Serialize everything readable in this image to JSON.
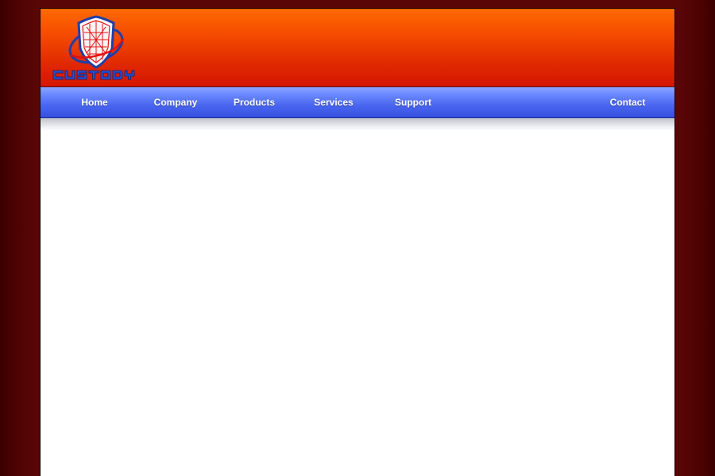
{
  "brand": {
    "logo_text": "CUSTODY"
  },
  "nav": {
    "items": [
      {
        "id": "home",
        "label": "Home"
      },
      {
        "id": "company",
        "label": "Company"
      },
      {
        "id": "products",
        "label": "Products"
      },
      {
        "id": "services",
        "label": "Services"
      },
      {
        "id": "support",
        "label": "Support"
      },
      {
        "id": "contact",
        "label": "Contact"
      }
    ]
  },
  "colors": {
    "background": "#5a0606",
    "header_gradient_top": "#ff6a00",
    "header_gradient_bottom": "#d41500",
    "nav_gradient_top": "#8aa4ff",
    "nav_gradient_bottom": "#3550de",
    "nav_text": "#ffffff",
    "logo_blue": "#1f3fa8",
    "logo_red": "#e01010"
  },
  "icons": {
    "logo": "shield-globe-logo"
  }
}
